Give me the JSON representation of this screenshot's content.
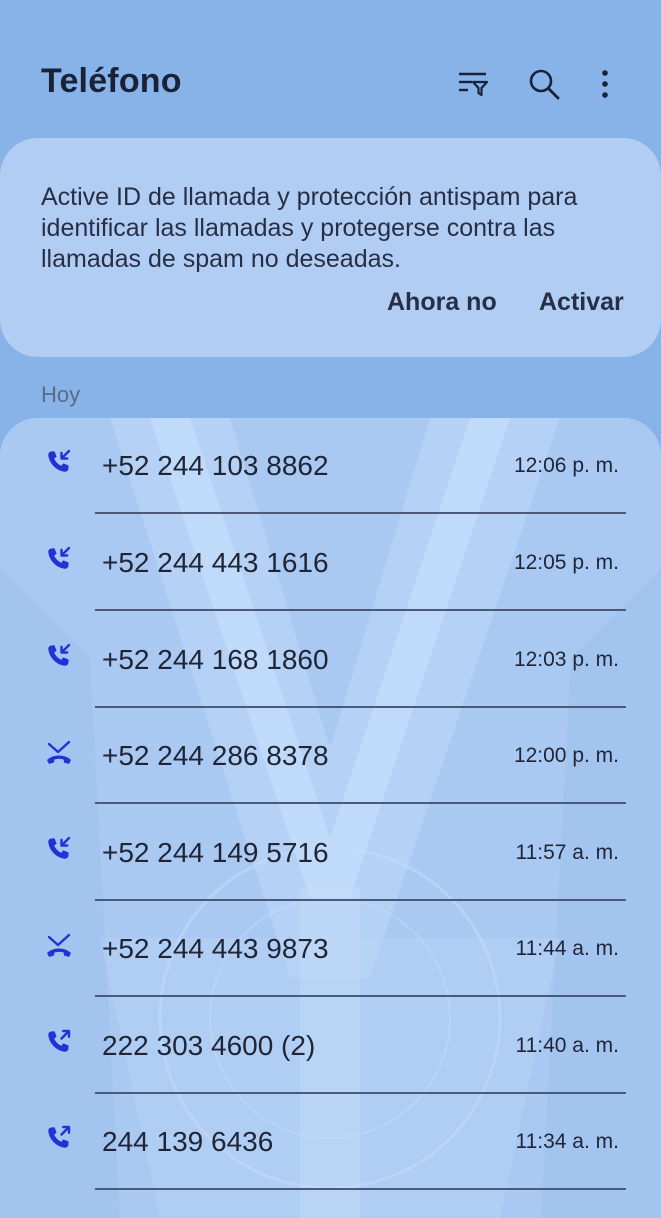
{
  "header": {
    "title": "Teléfono",
    "icons": [
      "filter-icon",
      "search-icon",
      "more-options-icon"
    ]
  },
  "banner": {
    "message": "Active ID de llamada y protección antispam para identificar las llamadas y protegerse contra las llamadas de spam no deseadas.",
    "later_label": "Ahora no",
    "activate_label": "Activar"
  },
  "calls": {
    "section_label": "Hoy",
    "items": [
      {
        "number": "+52 244 103 8862",
        "time": "12:06 p. m.",
        "type": "incoming-call-icon"
      },
      {
        "number": "+52 244 443 1616",
        "time": "12:05 p. m.",
        "type": "incoming-call-icon"
      },
      {
        "number": "+52 244 168 1860",
        "time": "12:03 p. m.",
        "type": "incoming-call-icon"
      },
      {
        "number": "+52 244 286 8378",
        "time": "12:00 p. m.",
        "type": "missed-call-icon"
      },
      {
        "number": "+52 244 149 5716",
        "time": "11:57 a. m.",
        "type": "incoming-call-icon"
      },
      {
        "number": "+52 244 443 9873",
        "time": "11:44 a. m.",
        "type": "missed-call-icon"
      },
      {
        "number": "222 303 4600 (2)",
        "time": "11:40 a. m.",
        "type": "outgoing-call-icon"
      },
      {
        "number": "244 139 6436",
        "time": "11:34 a. m.",
        "type": "outgoing-call-icon"
      }
    ]
  },
  "colors": {
    "background": "#87b3e8",
    "banner": "#b2cdf3",
    "list_card": "#aac9f2",
    "call_icon": "#2431d6",
    "text": "#1f2536"
  }
}
